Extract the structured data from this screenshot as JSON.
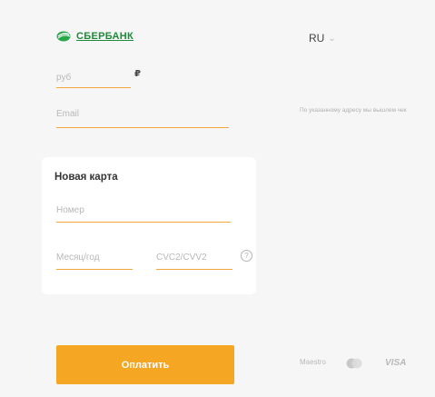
{
  "header": {
    "brand": "СБЕРБАНК",
    "language": "RU"
  },
  "payment": {
    "amount_placeholder": "руб",
    "currency_symbol": "₽",
    "email_placeholder": "Email",
    "email_hint": "По указанному адресу мы вышлем чек"
  },
  "card": {
    "title": "Новая карта",
    "number_placeholder": "Номер",
    "expiry_placeholder": "Месяц/год",
    "cvc_placeholder": "CVC2/CVV2",
    "help_icon": "question-circle-icon"
  },
  "actions": {
    "pay_label": "Оплатить"
  },
  "payment_systems": {
    "maestro": "Maestro",
    "mastercard_icon": "mastercard-logo-icon",
    "visa": "VISA"
  },
  "colors": {
    "accent": "#f5a623",
    "brand_green": "#1f8a3a",
    "background": "#f6f6f6"
  }
}
